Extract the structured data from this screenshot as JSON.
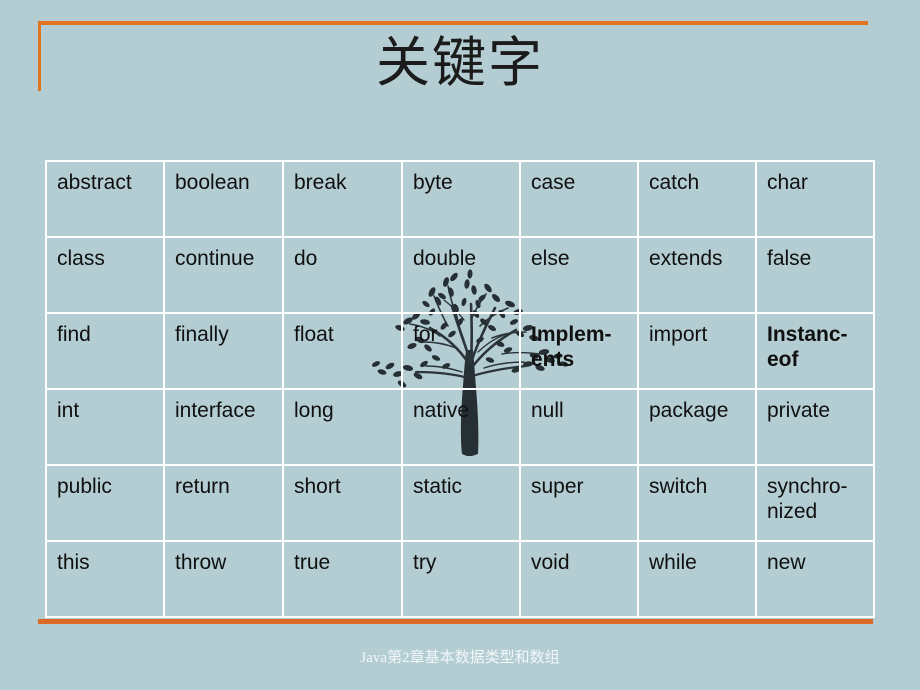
{
  "slide": {
    "title": "关键字",
    "footer": "Java第2章基本数据类型和数组",
    "background_color": "#b3cdd3",
    "accent_color": "#e2741f",
    "border_color": "#ffffff",
    "text_color": "#101010",
    "footer_color": "#f2f7f8",
    "decoration": "tree-silhouette"
  },
  "table": {
    "columns": 7,
    "rows": 6,
    "cells": [
      [
        {
          "text": "abstract",
          "bold": false
        },
        {
          "text": "boolean",
          "bold": false
        },
        {
          "text": "break",
          "bold": false
        },
        {
          "text": "byte",
          "bold": false
        },
        {
          "text": "case",
          "bold": false
        },
        {
          "text": "catch",
          "bold": false
        },
        {
          "text": "char",
          "bold": false
        }
      ],
      [
        {
          "text": "class",
          "bold": false
        },
        {
          "text": "continue",
          "bold": false
        },
        {
          "text": "do",
          "bold": false
        },
        {
          "text": "double",
          "bold": false
        },
        {
          "text": "else",
          "bold": false
        },
        {
          "text": "extends",
          "bold": false
        },
        {
          "text": "false",
          "bold": false
        }
      ],
      [
        {
          "text": "find",
          "bold": false
        },
        {
          "text": "finally",
          "bold": false
        },
        {
          "text": "float",
          "bold": false
        },
        {
          "text": "for",
          "bold": false
        },
        {
          "text": "Implem-ents",
          "bold": true
        },
        {
          "text": "import",
          "bold": false
        },
        {
          "text": "Instanc-eof",
          "bold": true
        }
      ],
      [
        {
          "text": "int",
          "bold": false
        },
        {
          "text": "interface",
          "bold": false
        },
        {
          "text": "long",
          "bold": false
        },
        {
          "text": "native",
          "bold": false
        },
        {
          "text": "null",
          "bold": false
        },
        {
          "text": "package",
          "bold": false
        },
        {
          "text": "private",
          "bold": false
        }
      ],
      [
        {
          "text": "public",
          "bold": false
        },
        {
          "text": "return",
          "bold": false
        },
        {
          "text": "short",
          "bold": false
        },
        {
          "text": "static",
          "bold": false
        },
        {
          "text": "super",
          "bold": false
        },
        {
          "text": "switch",
          "bold": false
        },
        {
          "text": "synchro-nized",
          "bold": false
        }
      ],
      [
        {
          "text": "this",
          "bold": false
        },
        {
          "text": "throw",
          "bold": false
        },
        {
          "text": "true",
          "bold": false
        },
        {
          "text": "try",
          "bold": false
        },
        {
          "text": "void",
          "bold": false
        },
        {
          "text": "while",
          "bold": false
        },
        {
          "text": "new",
          "bold": false
        }
      ]
    ]
  }
}
